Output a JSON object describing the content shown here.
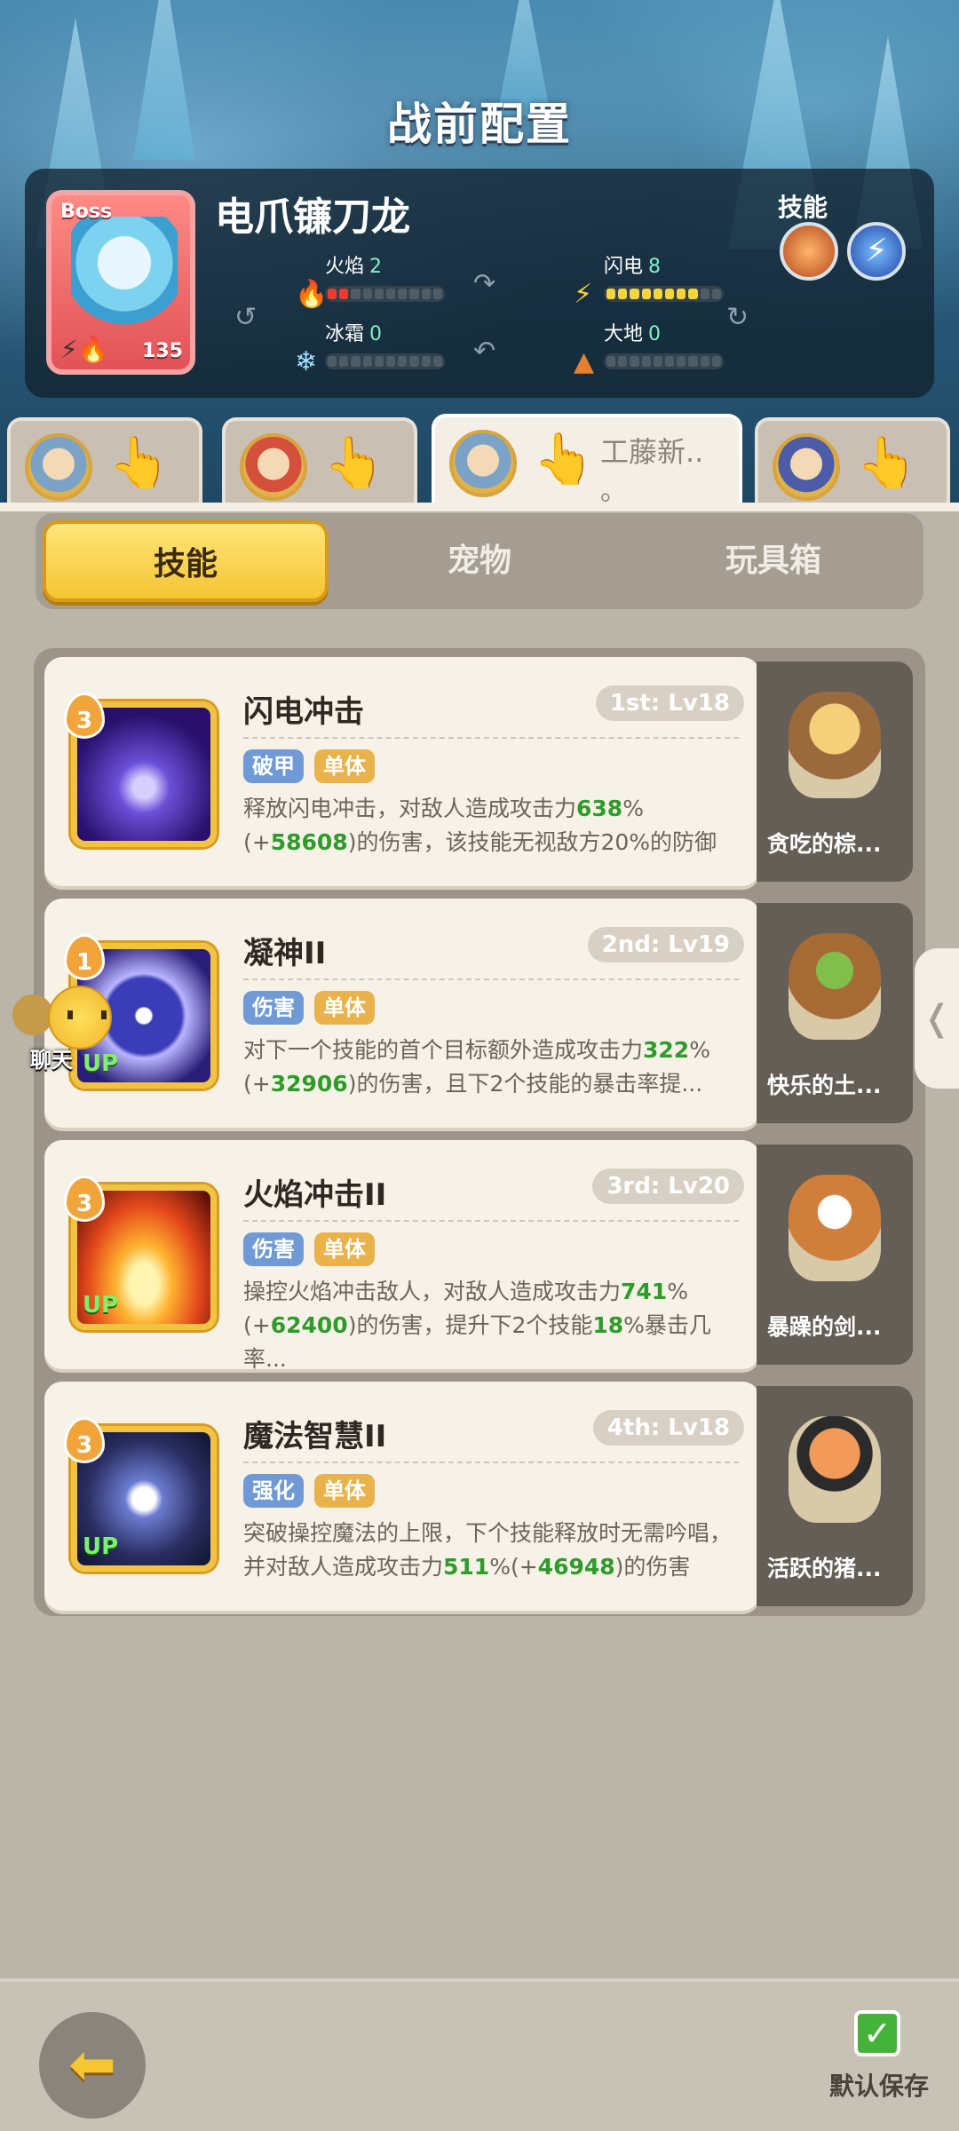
{
  "header": {
    "title": "战前配置"
  },
  "boss": {
    "badge": "Boss",
    "name": "电爪镰刀龙",
    "level": "135",
    "skills_label": "技能",
    "stats": {
      "fire": {
        "label": "火焰",
        "value": "2",
        "filled": 2
      },
      "lightning": {
        "label": "闪电",
        "value": "8",
        "filled": 8
      },
      "ice": {
        "label": "冰霜",
        "value": "0",
        "filled": 0
      },
      "earth": {
        "label": "大地",
        "value": "0",
        "filled": 0
      }
    },
    "stat_segments": 10
  },
  "team_tabs": [
    {
      "active": false
    },
    {
      "active": false
    },
    {
      "active": true,
      "name": "工藤新..",
      "name2": "。"
    },
    {
      "active": false
    }
  ],
  "tabs": [
    "技能",
    "宠物",
    "玩具箱"
  ],
  "skills": [
    {
      "rank": "3",
      "name": "闪电冲击",
      "level": "1st: Lv18",
      "tags": [
        "破甲",
        "单体"
      ],
      "desc_parts": [
        "释放闪电冲击，对敌人造成攻击力",
        "638",
        "%(+",
        "58608",
        ")的伤害，该技能无视敌方20%的防御"
      ],
      "up": false,
      "pet": "贪吃的棕..."
    },
    {
      "rank": "1",
      "name": "凝神II",
      "level": "2nd: Lv19",
      "tags": [
        "伤害",
        "单体"
      ],
      "desc_parts": [
        "对下一个技能的首个目标额外造成攻击力",
        "322",
        "%(+",
        "32906",
        ")的伤害，且下2个技能的暴击率提..."
      ],
      "up": true,
      "pet": "快乐的土..."
    },
    {
      "rank": "3",
      "name": "火焰冲击II",
      "level": "3rd: Lv20",
      "tags": [
        "伤害",
        "单体"
      ],
      "desc_parts": [
        "操控火焰冲击敌人，对敌人造成攻击力",
        "741",
        "%(+",
        "62400",
        ")的伤害，提升下2个技能",
        "18",
        "%暴击几率..."
      ],
      "up": true,
      "pet": "暴躁的剑..."
    },
    {
      "rank": "3",
      "name": "魔法智慧II",
      "level": "4th: Lv18",
      "tags": [
        "强化",
        "单体"
      ],
      "desc_parts": [
        "突破操控魔法的上限，下个技能释放时无需吟唱，并对敌人造成攻击力",
        "511",
        "%(+",
        "46948",
        ")的伤害"
      ],
      "up": true,
      "pet": "活跃的猪..."
    }
  ],
  "up_label": "UP",
  "chat": {
    "label": "聊天"
  },
  "footer": {
    "save_label": "默认保存"
  },
  "colors": {
    "accent": "#f5c533",
    "highlight_green": "#2e9b2a",
    "fire": "#ee3b2e",
    "lightning": "#f6d43c"
  }
}
